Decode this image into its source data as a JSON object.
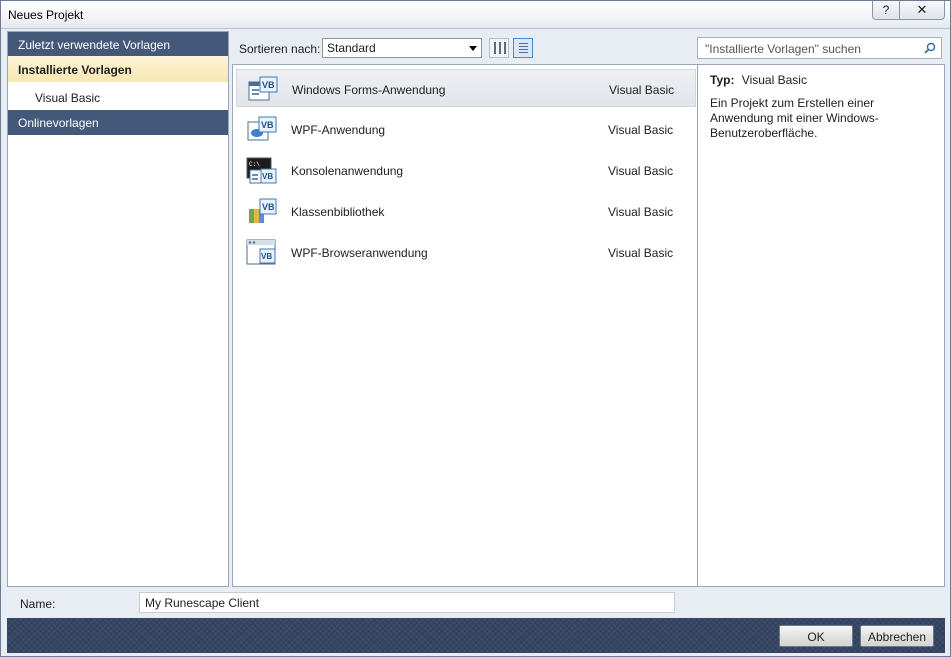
{
  "window": {
    "title": "Neues Projekt",
    "help_glyph": "?",
    "close_glyph": "✕"
  },
  "nav": {
    "recent": "Zuletzt verwendete Vorlagen",
    "installed": "Installierte Vorlagen",
    "installed_sub": "Visual Basic",
    "online": "Onlinevorlagen"
  },
  "toolbar": {
    "sort_label": "Sortieren nach:",
    "sort_value": "Standard",
    "search_placeholder": "\"Installierte Vorlagen\" suchen"
  },
  "templates": [
    {
      "name": "Windows Forms-Anwendung",
      "lang": "Visual Basic",
      "icon": "winforms-vb-icon",
      "selected": true
    },
    {
      "name": "WPF-Anwendung",
      "lang": "Visual Basic",
      "icon": "wpf-vb-icon",
      "selected": false
    },
    {
      "name": "Konsolenanwendung",
      "lang": "Visual Basic",
      "icon": "console-vb-icon",
      "selected": false
    },
    {
      "name": "Klassenbibliothek",
      "lang": "Visual Basic",
      "icon": "classlib-vb-icon",
      "selected": false
    },
    {
      "name": "WPF-Browseranwendung",
      "lang": "Visual Basic",
      "icon": "wpf-browser-vb-icon",
      "selected": false
    }
  ],
  "details": {
    "type_label": "Typ:",
    "type_value": "Visual Basic",
    "description": "Ein Projekt zum Erstellen einer Anwendung mit einer Windows-Benutzeroberfläche."
  },
  "name_row": {
    "label": "Name:",
    "value": "My Runescape Client"
  },
  "buttons": {
    "ok": "OK",
    "cancel": "Abbrechen"
  },
  "colors": {
    "nav_header": "#44587a",
    "selected_nav": "#f8e7b3",
    "bottom_bar": "#2f3f5c"
  }
}
